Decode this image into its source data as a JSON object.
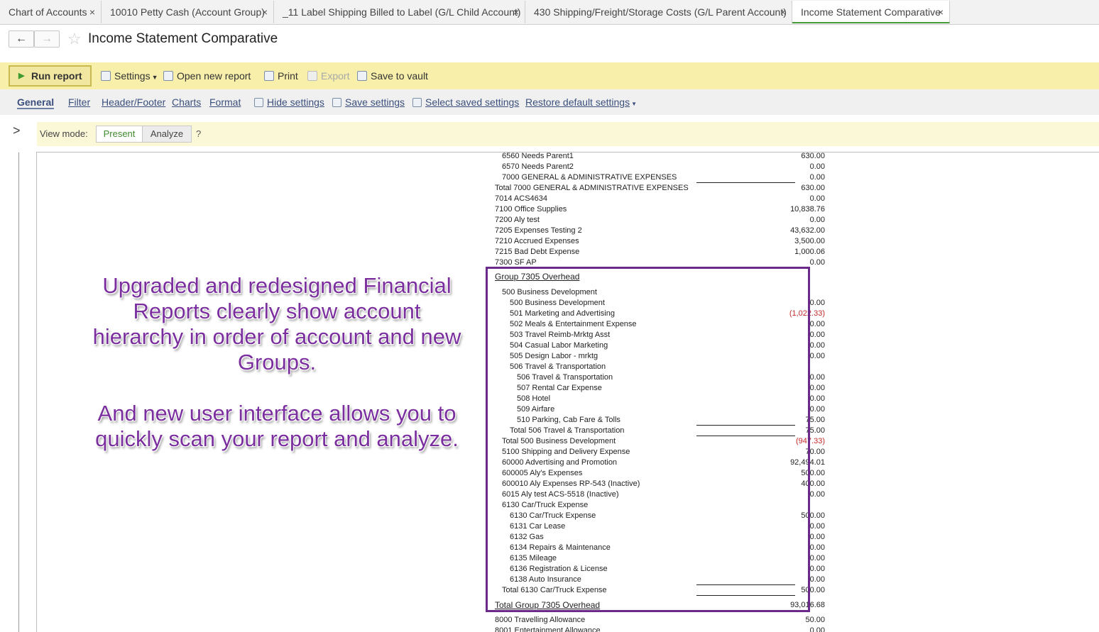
{
  "tabs": [
    {
      "label": "Chart of Accounts",
      "active": false
    },
    {
      "label": "10010 Petty Cash (Account Group)",
      "active": false
    },
    {
      "label": "_11 Label Shipping Billed to Label (G/L Child Account)",
      "active": false
    },
    {
      "label": "430 Shipping/Freight/Storage Costs (G/L Parent Account)",
      "active": false
    },
    {
      "label": "Income Statement Comparative",
      "active": true
    }
  ],
  "nav": {
    "back": "←",
    "forward": "→",
    "star": "☆"
  },
  "page_title": "Income Statement Comparative",
  "toolbar": {
    "run_report": "Run report",
    "settings": "Settings",
    "open_new_report": "Open new report",
    "print": "Print",
    "export": "Export",
    "save_to_vault": "Save to vault"
  },
  "settings_tabs": {
    "general": "General",
    "filter": "Filter",
    "header_footer": "Header/Footer",
    "charts": "Charts",
    "format": "Format",
    "hide_settings": "Hide settings",
    "save_settings": "Save settings",
    "select_saved_settings": "Select saved settings",
    "restore_default_settings": "Restore default settings"
  },
  "view_mode": {
    "label": "View mode:",
    "present": "Present",
    "analyze": "Analyze",
    "help": "?"
  },
  "report_rows": [
    {
      "label": "6560 Needs Parent1",
      "value": "630.00",
      "level": 1
    },
    {
      "label": "6570 Needs Parent2",
      "value": "0.00",
      "level": 1
    },
    {
      "label": "7000 GENERAL & ADMINISTRATIVE EXPENSES",
      "value": "0.00",
      "level": 1,
      "underline": true
    },
    {
      "label": "Total 7000 GENERAL & ADMINISTRATIVE EXPENSES",
      "value": "630.00",
      "level": 0
    },
    {
      "label": "7014 ACS4634",
      "value": "0.00",
      "level": 0
    },
    {
      "label": "7100 Office Supplies",
      "value": "10,838.76",
      "level": 0
    },
    {
      "label": "7200 Aly test",
      "value": "0.00",
      "level": 0
    },
    {
      "label": "7205 Expenses Testing 2",
      "value": "43,632.00",
      "level": 0
    },
    {
      "label": "7210 Accrued Expenses",
      "value": "3,500.00",
      "level": 0
    },
    {
      "label": "7215 Bad Debt Expense",
      "value": "1,000.06",
      "level": 0
    },
    {
      "label": "7300 SF AP",
      "value": "0.00",
      "level": 0
    },
    {
      "label": "Group 7305 Overhead",
      "value": "",
      "level": 0,
      "group": true
    },
    {
      "label": "500 Business Development",
      "value": "",
      "level": 1
    },
    {
      "label": "500 Business Development",
      "value": "0.00",
      "level": 2
    },
    {
      "label": "501 Marketing and Advertising",
      "value": "(1,022.33)",
      "level": 2,
      "negative": true
    },
    {
      "label": "502 Meals & Entertainment Expense",
      "value": "0.00",
      "level": 2
    },
    {
      "label": "503 Travel Reimb-Mrktg Asst",
      "value": "0.00",
      "level": 2
    },
    {
      "label": "504 Casual Labor Marketing",
      "value": "0.00",
      "level": 2
    },
    {
      "label": "505 Design Labor - mrktg",
      "value": "0.00",
      "level": 2
    },
    {
      "label": "506 Travel & Transportation",
      "value": "",
      "level": 2
    },
    {
      "label": "506 Travel & Transportation",
      "value": "0.00",
      "level": 3
    },
    {
      "label": "507 Rental Car Expense",
      "value": "0.00",
      "level": 3
    },
    {
      "label": "508 Hotel",
      "value": "0.00",
      "level": 3
    },
    {
      "label": "509 Airfare",
      "value": "0.00",
      "level": 3
    },
    {
      "label": "510 Parking, Cab Fare & Tolls",
      "value": "75.00",
      "level": 3,
      "underline": true
    },
    {
      "label": "Total 506 Travel & Transportation",
      "value": "75.00",
      "level": 2,
      "underline": true
    },
    {
      "label": "Total 500 Business Development",
      "value": "(947.33)",
      "level": 1,
      "negative": true
    },
    {
      "label": "5100 Shipping and Delivery Expense",
      "value": "70.00",
      "level": 1
    },
    {
      "label": "60000 Advertising and Promotion",
      "value": "92,494.01",
      "level": 1
    },
    {
      "label": "600005 Aly's Expenses",
      "value": "500.00",
      "level": 1
    },
    {
      "label": "600010 Aly Expenses RP-543 (Inactive)",
      "value": "400.00",
      "level": 1
    },
    {
      "label": "6015 Aly test ACS-5518 (Inactive)",
      "value": "0.00",
      "level": 1
    },
    {
      "label": "6130 Car/Truck Expense",
      "value": "",
      "level": 1
    },
    {
      "label": "6130 Car/Truck Expense",
      "value": "500.00",
      "level": 2
    },
    {
      "label": "6131 Car Lease",
      "value": "0.00",
      "level": 2
    },
    {
      "label": "6132 Gas",
      "value": "0.00",
      "level": 2
    },
    {
      "label": "6134 Repairs & Maintenance",
      "value": "0.00",
      "level": 2
    },
    {
      "label": "6135 Mileage",
      "value": "0.00",
      "level": 2
    },
    {
      "label": "6136 Registration & License",
      "value": "0.00",
      "level": 2
    },
    {
      "label": "6138 Auto Insurance",
      "value": "0.00",
      "level": 2,
      "underline": true
    },
    {
      "label": "Total 6130 Car/Truck Expense",
      "value": "500.00",
      "level": 1,
      "underline": true
    },
    {
      "label": "Total Group 7305 Overhead",
      "value": "93,016.68",
      "level": 0,
      "group": true
    },
    {
      "label": "8000 Travelling Allowance",
      "value": "50.00",
      "level": 0
    },
    {
      "label": "8001 Entertainment Allowance",
      "value": "0.00",
      "level": 0
    }
  ],
  "annotation": {
    "paragraph1": "Upgraded and redesigned Financial Reports clearly show account hierarchy in order of account and new Groups.",
    "paragraph2": "And new user interface allows you to quickly scan your report and analyze."
  }
}
